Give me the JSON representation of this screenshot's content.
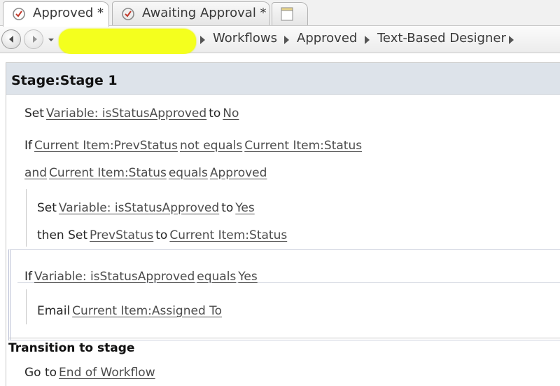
{
  "tabs": [
    {
      "label": "Approved *",
      "active": true,
      "icon": "workflow-icon"
    },
    {
      "label": "Awaiting Approval *",
      "active": false,
      "icon": "workflow-icon"
    }
  ],
  "breadcrumb": {
    "items": [
      "Workflows",
      "Approved",
      "Text-Based Designer"
    ]
  },
  "stage": {
    "label": "Stage:",
    "name": "Stage 1"
  },
  "step1": {
    "kw_set": "Set",
    "target": "Variable: isStatusApproved",
    "kw_to": "to",
    "value": "No"
  },
  "cond1": {
    "kw_if": "If",
    "left": "Current Item:PrevStatus",
    "op": "not equals",
    "right": "Current Item:Status",
    "kw_and": "and",
    "left2": "Current Item:Status",
    "op2": "equals",
    "right2": "Approved"
  },
  "action1": {
    "kw_set": "Set",
    "target": "Variable: isStatusApproved",
    "kw_to": "to",
    "value": "Yes"
  },
  "action2": {
    "kw_then_set": "then Set",
    "target": "PrevStatus",
    "kw_to": "to",
    "value": "Current Item:Status"
  },
  "cond2": {
    "kw_if": "If",
    "left": "Variable: isStatusApproved",
    "op": "equals",
    "right": "Yes"
  },
  "action3": {
    "kw_email": "Email",
    "target": "Current Item:Assigned To"
  },
  "transition": {
    "title": "Transition to stage",
    "kw_goto": "Go to",
    "target": "End of Workflow"
  },
  "colors": {
    "stage_header": "#dde3ea",
    "highlight": "#f4ff1e",
    "text": "#262626"
  }
}
